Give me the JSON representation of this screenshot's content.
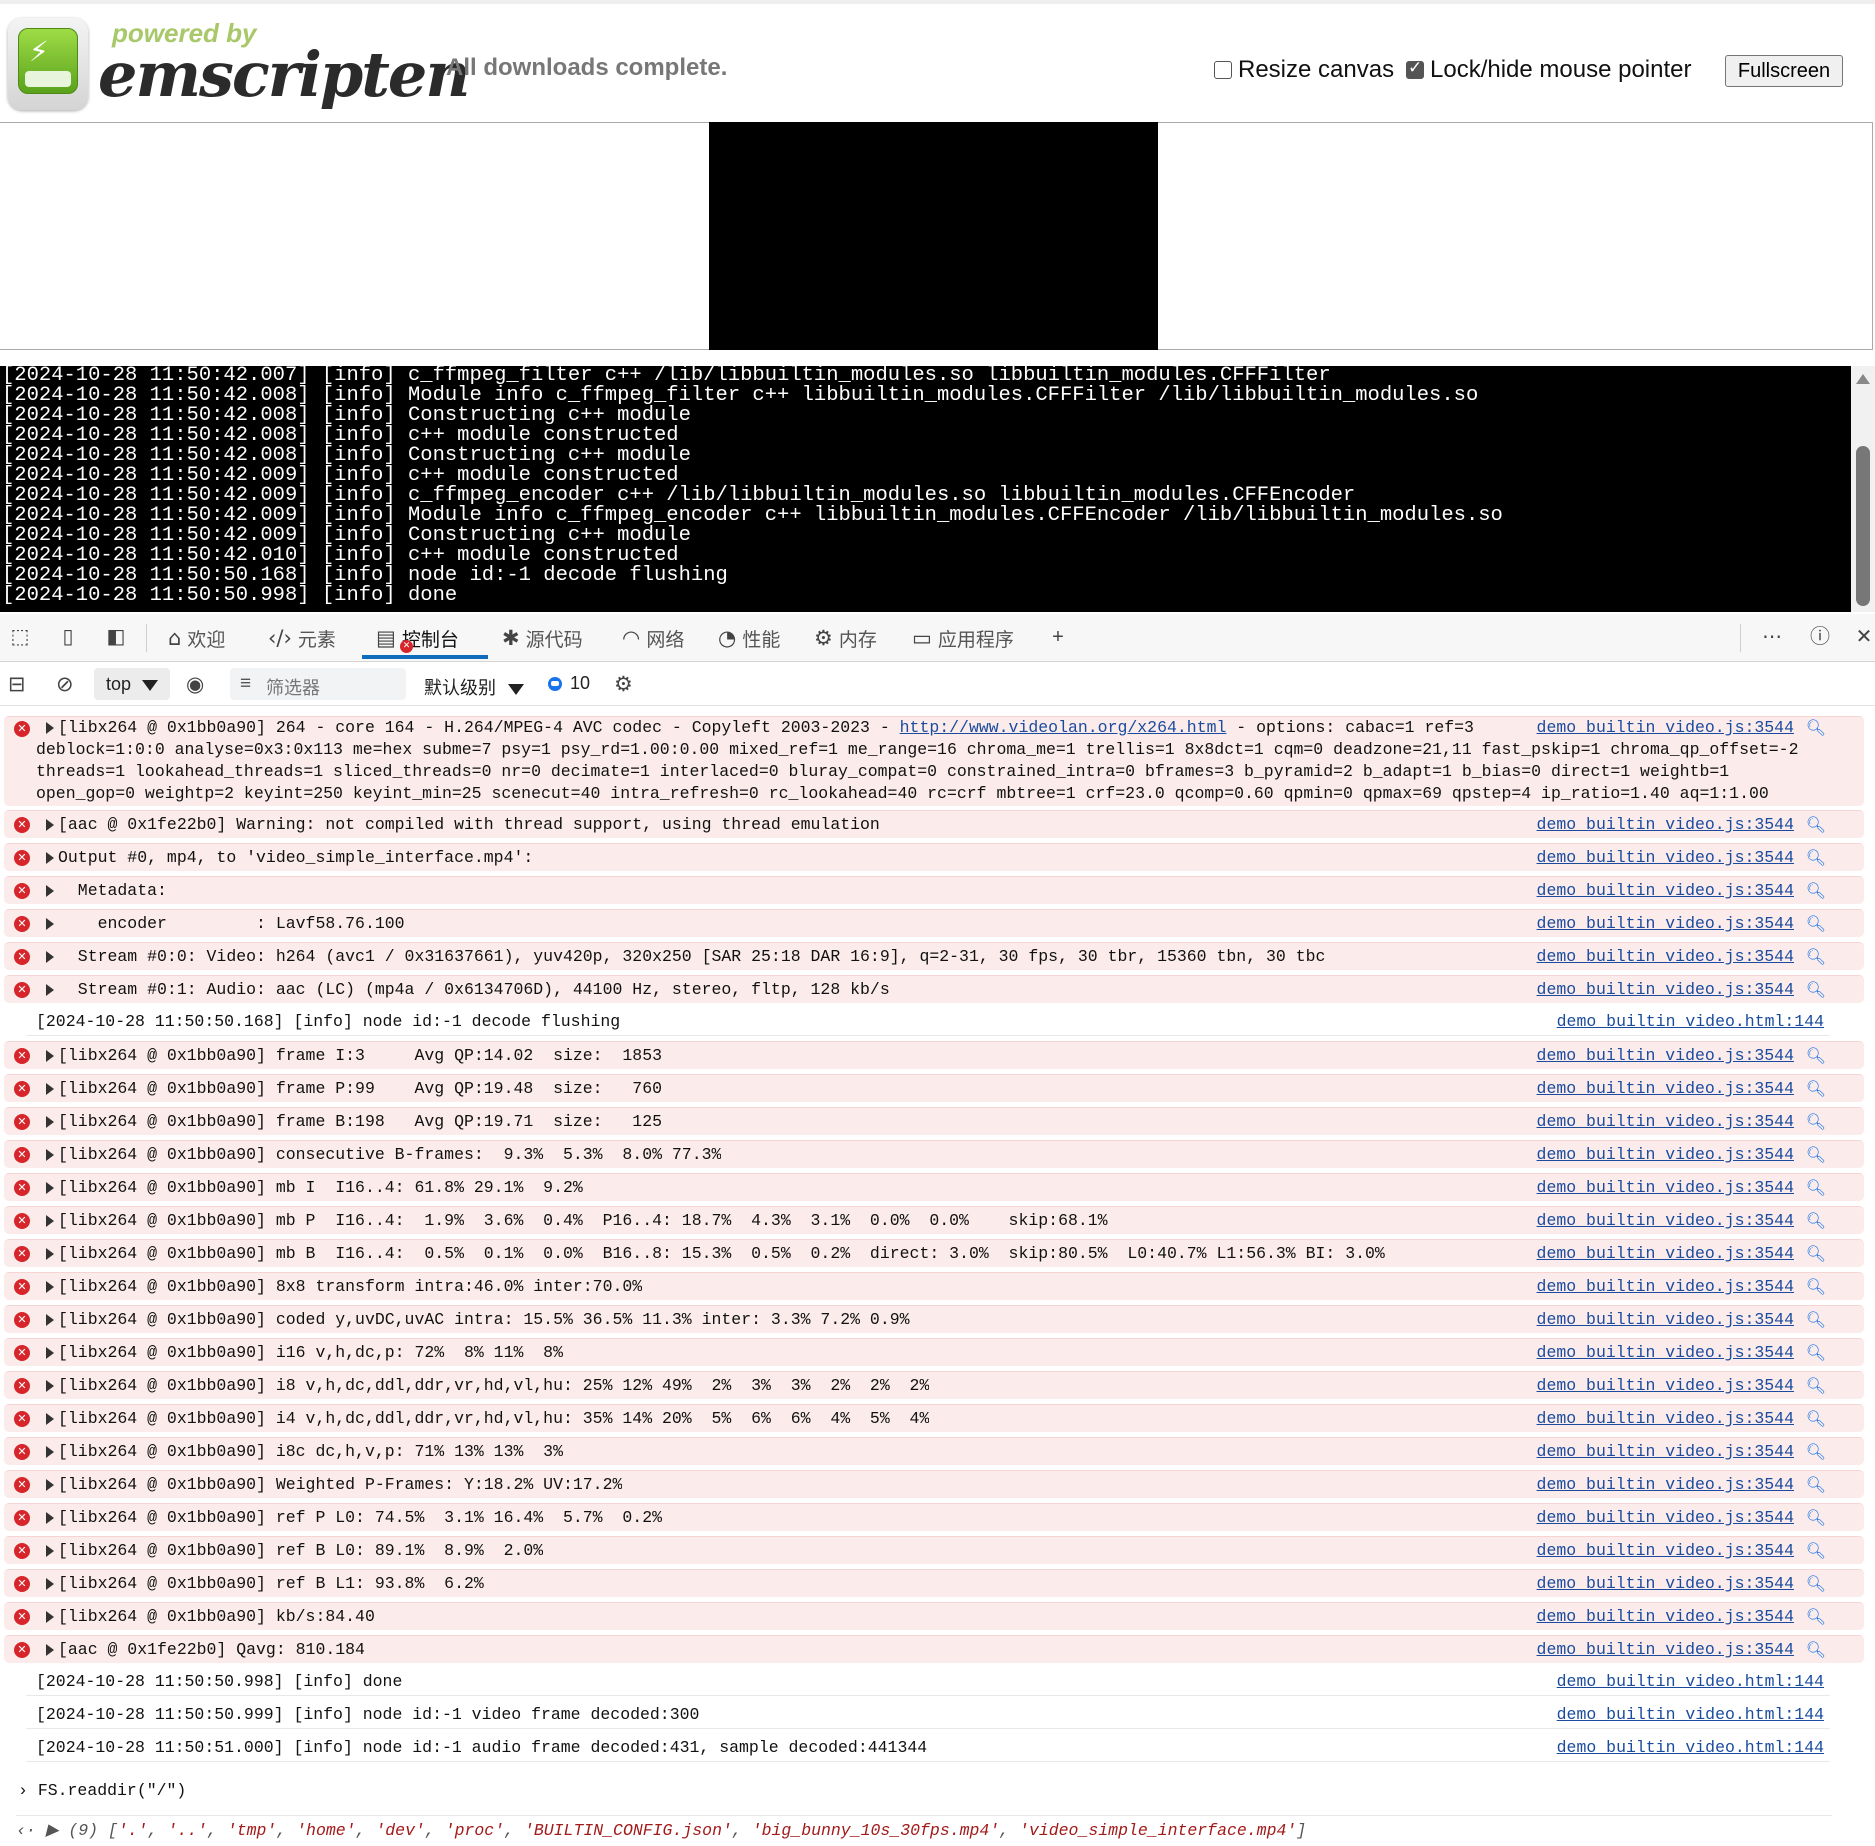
{
  "header": {
    "powered_by": "powered by",
    "brand": "emscripten",
    "status": "All downloads complete.",
    "resize_canvas_label": "Resize canvas",
    "resize_canvas_checked": false,
    "lock_pointer_label": "Lock/hide mouse pointer",
    "lock_pointer_checked": true,
    "fullscreen_label": "Fullscreen"
  },
  "output_lines": [
    "[2024-10-28 11:50:42.007] [info] c_ffmpeg_filter c++ /lib/libbuiltin_modules.so libbuiltin_modules.CFFFilter",
    "[2024-10-28 11:50:42.008] [info] Module info c_ffmpeg_filter c++ libbuiltin_modules.CFFFilter /lib/libbuiltin_modules.so",
    "[2024-10-28 11:50:42.008] [info] Constructing c++ module",
    "[2024-10-28 11:50:42.008] [info] c++ module constructed",
    "[2024-10-28 11:50:42.008] [info] Constructing c++ module",
    "[2024-10-28 11:50:42.009] [info] c++ module constructed",
    "[2024-10-28 11:50:42.009] [info] c_ffmpeg_encoder c++ /lib/libbuiltin_modules.so libbuiltin_modules.CFFEncoder",
    "[2024-10-28 11:50:42.009] [info] Module info c_ffmpeg_encoder c++ libbuiltin_modules.CFFEncoder /lib/libbuiltin_modules.so",
    "[2024-10-28 11:50:42.009] [info] Constructing c++ module",
    "[2024-10-28 11:50:42.010] [info] c++ module constructed",
    "[2024-10-28 11:50:50.168] [info] node id:-1 decode flushing",
    "[2024-10-28 11:50:50.998] [info] done"
  ],
  "devtools": {
    "tabs": [
      {
        "label": "欢迎",
        "icon": "home-icon"
      },
      {
        "label": "元素",
        "icon": "code-icon"
      },
      {
        "label": "控制台",
        "icon": "console-icon"
      },
      {
        "label": "源代码",
        "icon": "bug-icon"
      },
      {
        "label": "网络",
        "icon": "wifi-icon"
      },
      {
        "label": "性能",
        "icon": "gauge-icon"
      },
      {
        "label": "内存",
        "icon": "chip-icon"
      },
      {
        "label": "应用程序",
        "icon": "window-icon"
      }
    ],
    "active_tab": "控制台",
    "accent_color": "#0f6cbd",
    "error_color": "#d7262b"
  },
  "console_toolbar": {
    "context": "top",
    "filter_placeholder": "筛选器",
    "level": "默认级别",
    "message_count": "10"
  },
  "first_message": {
    "line1_prefix": "[libx264 @ 0x1bb0a90] 264 - core 164 - H.264/MPEG-4 AVC codec - Copyleft 2003-2023 - ",
    "line1_link": "http://www.videolan.org/x264.html",
    "line1_suffix": " - options: cabac=1 ref=3",
    "line2": "deblock=1:0:0 analyse=0x3:0x113 me=hex subme=7 psy=1 psy_rd=1.00:0.00 mixed_ref=1 me_range=16 chroma_me=1 trellis=1 8x8dct=1 cqm=0 deadzone=21,11 fast_pskip=1 chroma_qp_offset=-2",
    "line3": "threads=1 lookahead_threads=1 sliced_threads=0 nr=0 decimate=1 interlaced=0 bluray_compat=0 constrained_intra=0 bframes=3 b_pyramid=2 b_adapt=1 b_bias=0 direct=1 weightb=1",
    "line4": "open_gop=0 weightp=2 keyint=250 keyint_min=25 scenecut=40 intra_refresh=0 rc_lookahead=40 rc=crf mbtree=1 crf=23.0 qcomp=0.60 qpmin=0 qpmax=69 qpstep=4 ip_ratio=1.40 aq=1:1.00",
    "source": "demo_builtin_video.js:3544"
  },
  "messages": [
    {
      "type": "error",
      "text": "[aac @ 0x1fe22b0] Warning: not compiled with thread support, using thread emulation",
      "source": "demo_builtin_video.js:3544"
    },
    {
      "type": "error",
      "text": "Output #0, mp4, to 'video_simple_interface.mp4':",
      "source": "demo_builtin_video.js:3544"
    },
    {
      "type": "error",
      "text": "  Metadata:",
      "source": "demo_builtin_video.js:3544"
    },
    {
      "type": "error",
      "text": "    encoder         : Lavf58.76.100",
      "source": "demo_builtin_video.js:3544"
    },
    {
      "type": "error",
      "text": "  Stream #0:0: Video: h264 (avc1 / 0x31637661), yuv420p, 320x250 [SAR 25:18 DAR 16:9], q=2-31, 30 fps, 30 tbr, 15360 tbn, 30 tbc",
      "source": "demo_builtin_video.js:3544"
    },
    {
      "type": "error",
      "text": "  Stream #0:1: Audio: aac (LC) (mp4a / 0x6134706D), 44100 Hz, stereo, fltp, 128 kb/s",
      "source": "demo_builtin_video.js:3544"
    },
    {
      "type": "info",
      "text": "[2024-10-28 11:50:50.168] [info] node id:-1 decode flushing",
      "source": "demo_builtin_video.html:144"
    },
    {
      "type": "error",
      "text": "[libx264 @ 0x1bb0a90] frame I:3     Avg QP:14.02  size:  1853",
      "source": "demo_builtin_video.js:3544"
    },
    {
      "type": "error",
      "text": "[libx264 @ 0x1bb0a90] frame P:99    Avg QP:19.48  size:   760",
      "source": "demo_builtin_video.js:3544"
    },
    {
      "type": "error",
      "text": "[libx264 @ 0x1bb0a90] frame B:198   Avg QP:19.71  size:   125",
      "source": "demo_builtin_video.js:3544"
    },
    {
      "type": "error",
      "text": "[libx264 @ 0x1bb0a90] consecutive B-frames:  9.3%  5.3%  8.0% 77.3%",
      "source": "demo_builtin_video.js:3544"
    },
    {
      "type": "error",
      "text": "[libx264 @ 0x1bb0a90] mb I  I16..4: 61.8% 29.1%  9.2%",
      "source": "demo_builtin_video.js:3544"
    },
    {
      "type": "error",
      "text": "[libx264 @ 0x1bb0a90] mb P  I16..4:  1.9%  3.6%  0.4%  P16..4: 18.7%  4.3%  3.1%  0.0%  0.0%    skip:68.1%",
      "source": "demo_builtin_video.js:3544"
    },
    {
      "type": "error",
      "text": "[libx264 @ 0x1bb0a90] mb B  I16..4:  0.5%  0.1%  0.0%  B16..8: 15.3%  0.5%  0.2%  direct: 3.0%  skip:80.5%  L0:40.7% L1:56.3% BI: 3.0%",
      "source": "demo_builtin_video.js:3544"
    },
    {
      "type": "error",
      "text": "[libx264 @ 0x1bb0a90] 8x8 transform intra:46.0% inter:70.0%",
      "source": "demo_builtin_video.js:3544"
    },
    {
      "type": "error",
      "text": "[libx264 @ 0x1bb0a90] coded y,uvDC,uvAC intra: 15.5% 36.5% 11.3% inter: 3.3% 7.2% 0.9%",
      "source": "demo_builtin_video.js:3544"
    },
    {
      "type": "error",
      "text": "[libx264 @ 0x1bb0a90] i16 v,h,dc,p: 72%  8% 11%  8%",
      "source": "demo_builtin_video.js:3544"
    },
    {
      "type": "error",
      "text": "[libx264 @ 0x1bb0a90] i8 v,h,dc,ddl,ddr,vr,hd,vl,hu: 25% 12% 49%  2%  3%  3%  2%  2%  2%",
      "source": "demo_builtin_video.js:3544"
    },
    {
      "type": "error",
      "text": "[libx264 @ 0x1bb0a90] i4 v,h,dc,ddl,ddr,vr,hd,vl,hu: 35% 14% 20%  5%  6%  6%  4%  5%  4%",
      "source": "demo_builtin_video.js:3544"
    },
    {
      "type": "error",
      "text": "[libx264 @ 0x1bb0a90] i8c dc,h,v,p: 71% 13% 13%  3%",
      "source": "demo_builtin_video.js:3544"
    },
    {
      "type": "error",
      "text": "[libx264 @ 0x1bb0a90] Weighted P-Frames: Y:18.2% UV:17.2%",
      "source": "demo_builtin_video.js:3544"
    },
    {
      "type": "error",
      "text": "[libx264 @ 0x1bb0a90] ref P L0: 74.5%  3.1% 16.4%  5.7%  0.2%",
      "source": "demo_builtin_video.js:3544"
    },
    {
      "type": "error",
      "text": "[libx264 @ 0x1bb0a90] ref B L0: 89.1%  8.9%  2.0%",
      "source": "demo_builtin_video.js:3544"
    },
    {
      "type": "error",
      "text": "[libx264 @ 0x1bb0a90] ref B L1: 93.8%  6.2%",
      "source": "demo_builtin_video.js:3544"
    },
    {
      "type": "error",
      "text": "[libx264 @ 0x1bb0a90] kb/s:84.40",
      "source": "demo_builtin_video.js:3544"
    },
    {
      "type": "error",
      "text": "[aac @ 0x1fe22b0] Qavg: 810.184",
      "source": "demo_builtin_video.js:3544"
    },
    {
      "type": "info",
      "text": "[2024-10-28 11:50:50.998] [info] done",
      "source": "demo_builtin_video.html:144"
    },
    {
      "type": "info",
      "text": "[2024-10-28 11:50:50.999] [info] node id:-1 video frame decoded:300",
      "source": "demo_builtin_video.html:144"
    },
    {
      "type": "info",
      "text": "[2024-10-28 11:50:51.000] [info] node id:-1 audio frame decoded:431, sample decoded:441344",
      "source": "demo_builtin_video.html:144"
    }
  ],
  "prompt": {
    "input": "FS.readdir(\"/\")",
    "result_count": "(9)",
    "result_items": [
      "'.'",
      "'..'",
      "'tmp'",
      "'home'",
      "'dev'",
      "'proc'",
      "'BUILTIN_CONFIG.json'",
      "'big_bunny_10s_30fps.mp4'",
      "'video_simple_interface.mp4'"
    ]
  }
}
